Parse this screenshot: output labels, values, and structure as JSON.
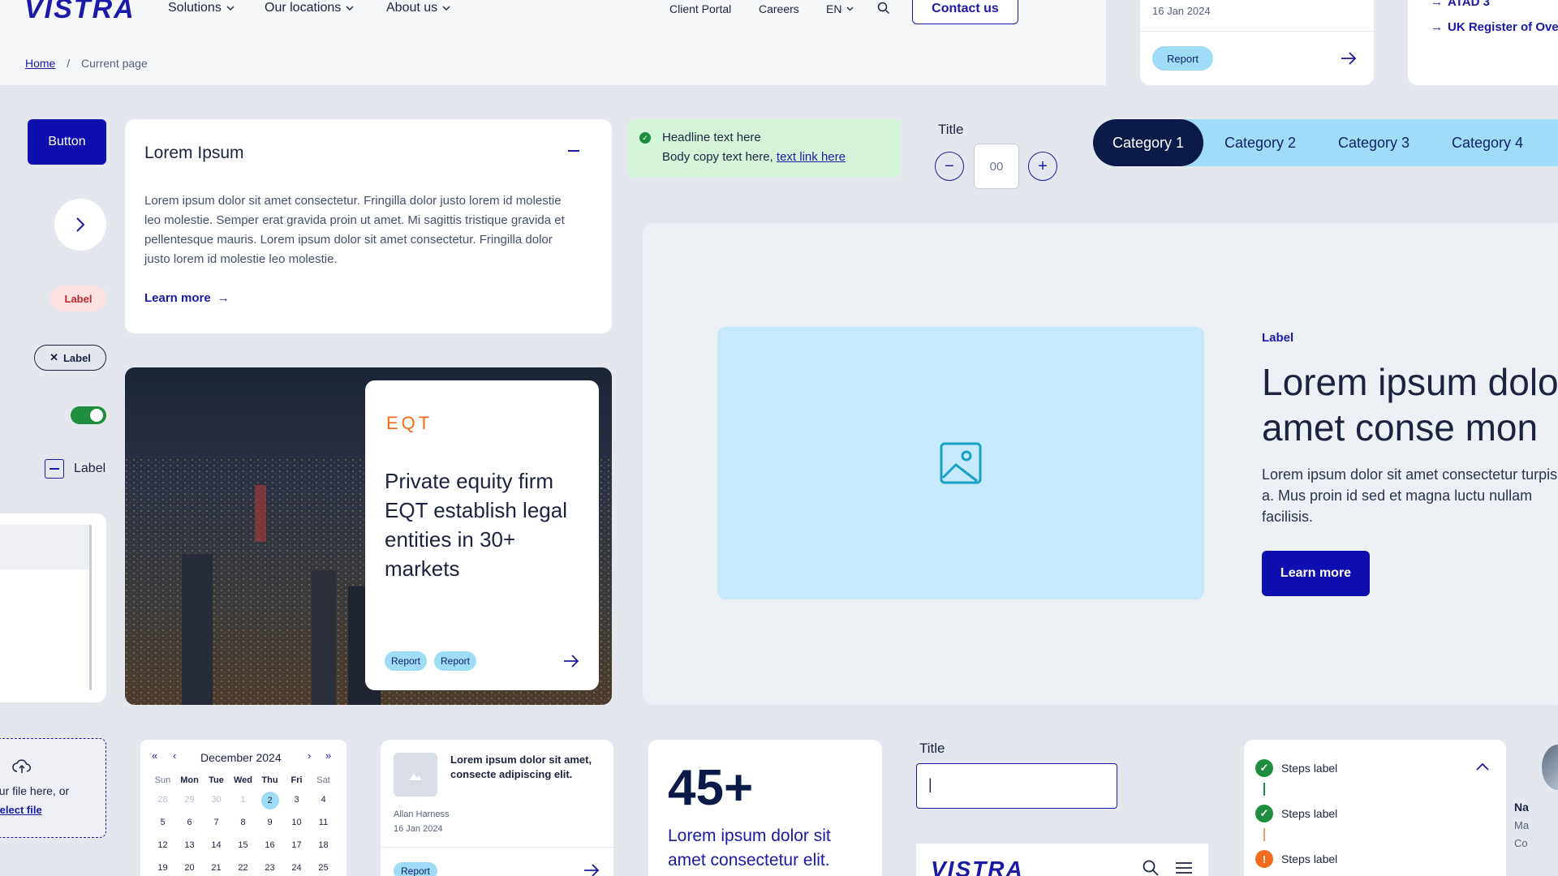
{
  "header": {
    "logo": "VISTRA",
    "nav": [
      "Solutions",
      "Our locations",
      "About us"
    ],
    "utility": [
      "Client Portal",
      "Careers",
      "EN"
    ],
    "contact_label": "Contact us",
    "breadcrumb": {
      "home": "Home",
      "separator": "/",
      "current": "Current page"
    }
  },
  "top_news_card": {
    "date": "16 Jan 2024",
    "tag": "Report"
  },
  "top_links": [
    "ATAD 3",
    "UK Register of Ove"
  ],
  "left_column": {
    "button_label": "Button",
    "label_badge": "Label",
    "chip_label": "Label",
    "toggle_on": true,
    "checkbox_label": "Label"
  },
  "accordion": {
    "title": "Lorem Ipsum",
    "body": "Lorem ipsum dolor sit amet consectetur. Fringilla dolor justo lorem id molestie leo molestie. Semper erat gravida proin ut amet. Mi sagittis tristique gravida et pellentesque mauris. Lorem ipsum dolor sit amet consectetur. Fringilla dolor justo lorem id molestie leo molestie.",
    "link": "Learn more"
  },
  "alert": {
    "headline": "Headline text here",
    "body": "Body copy text here,",
    "link": "text link here"
  },
  "stepper": {
    "title": "Title",
    "value": "00"
  },
  "tabs": [
    "Category 1",
    "Category 2",
    "Category 3",
    "Category 4"
  ],
  "feature_card": {
    "brand": "EQT",
    "headline": "Private equity firm EQT establish legal entities in 30+ markets",
    "tags": [
      "Report",
      "Report"
    ]
  },
  "hero": {
    "label": "Label",
    "title": "Lorem ipsum dolo amet conse mon",
    "body": "Lorem ipsum dolor sit amet consectetur turpis a. Mus proin id sed et magna luctu nullam facilisis.",
    "cta": "Learn more"
  },
  "upload": {
    "text": "our file here, or",
    "link": "Select file"
  },
  "calendar": {
    "month": "December 2024",
    "dow": [
      "Sun",
      "Mon",
      "Tue",
      "Wed",
      "Thu",
      "Fri",
      "Sat"
    ],
    "prev_days": [
      "28",
      "29",
      "30",
      "1"
    ],
    "days": [
      "2",
      "3",
      "4",
      "5",
      "6",
      "7",
      "8",
      "9",
      "10",
      "11",
      "12",
      "13",
      "14",
      "15",
      "16",
      "17",
      "18",
      "19",
      "20",
      "21",
      "22",
      "23",
      "24",
      "25"
    ],
    "selected": "2"
  },
  "article_card": {
    "title": "Lorem ipsum dolor sit amet, consecte adipiscing elit.",
    "author": "Allan Harness",
    "date": "16 Jan 2024",
    "tag": "Report"
  },
  "stat_card": {
    "number": "45+",
    "text": "Lorem ipsum dolor sit amet consectetur elit."
  },
  "input_field": {
    "title": "Title",
    "value": "|"
  },
  "mobile_header": {
    "logo": "VISTRA"
  },
  "steps": {
    "items": [
      "Steps label",
      "Steps label",
      "Steps label"
    ]
  },
  "profile": {
    "name": "Na",
    "line1": "Ma",
    "line2": "Co"
  },
  "colors": {
    "brand": "#1a1aa6",
    "accent": "#9fdcf7",
    "success": "#1e8e3e",
    "warning": "#f26a1b"
  }
}
